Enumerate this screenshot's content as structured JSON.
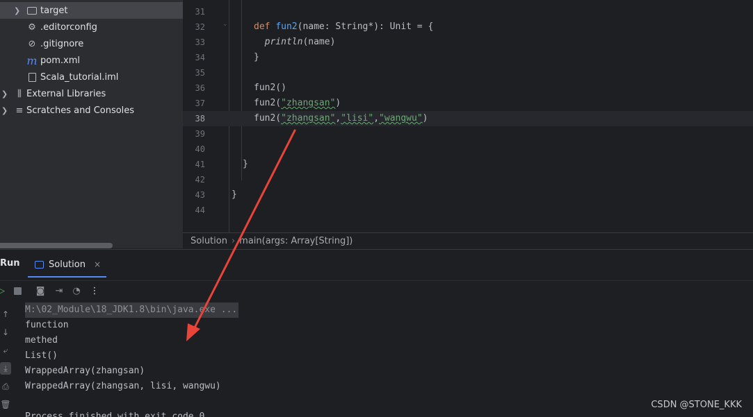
{
  "project_tree": {
    "items": [
      {
        "label": "target",
        "icon": "folder-icon",
        "expandable": true
      },
      {
        "label": ".editorconfig",
        "icon": "gear-icon"
      },
      {
        "label": ".gitignore",
        "icon": "ignore-file-icon"
      },
      {
        "label": "pom.xml",
        "icon": "maven-icon",
        "icon_glyph": "m"
      },
      {
        "label": "Scala_tutorial.iml",
        "icon": "file-icon"
      },
      {
        "label": "External Libraries",
        "icon": "library-icon",
        "expandable": true
      },
      {
        "label": "Scratches and Consoles",
        "icon": "scratches-icon",
        "expandable": true
      }
    ]
  },
  "editor": {
    "current_line": 38,
    "lines": [
      {
        "num": "31"
      },
      {
        "num": "32",
        "tokens": [
          {
            "t": "def ",
            "c": "kw"
          },
          {
            "t": "fun2",
            "c": "fn"
          },
          {
            "t": "(name: String*): Unit = {",
            "c": ""
          }
        ]
      },
      {
        "num": "33",
        "tokens": [
          {
            "t": "  ",
            "c": ""
          },
          {
            "t": "println",
            "c": "it"
          },
          {
            "t": "(name)",
            "c": ""
          }
        ]
      },
      {
        "num": "34",
        "tokens": [
          {
            "t": "}",
            "c": ""
          }
        ]
      },
      {
        "num": "35"
      },
      {
        "num": "36",
        "tokens": [
          {
            "t": "fun2()",
            "c": ""
          }
        ]
      },
      {
        "num": "37",
        "tokens": [
          {
            "t": "fun2(",
            "c": ""
          },
          {
            "t": "\"zhangsan\"",
            "c": "str"
          },
          {
            "t": ")",
            "c": ""
          }
        ]
      },
      {
        "num": "38",
        "tokens": [
          {
            "t": "fun2(",
            "c": ""
          },
          {
            "t": "\"zhangsan\"",
            "c": "str"
          },
          {
            "t": ",",
            "c": ""
          },
          {
            "t": "\"lisi\"",
            "c": "str"
          },
          {
            "t": ",",
            "c": ""
          },
          {
            "t": "\"wangwu\"",
            "c": "str"
          },
          {
            "t": ")",
            "c": ""
          }
        ]
      },
      {
        "num": "39"
      },
      {
        "num": "40"
      },
      {
        "num": "41",
        "tokens": [
          {
            "t": "}",
            "c": ""
          }
        ]
      },
      {
        "num": "42"
      },
      {
        "num": "43",
        "tokens": [
          {
            "t": "}",
            "c": ""
          }
        ]
      },
      {
        "num": "44"
      }
    ]
  },
  "breadcrumb": {
    "class_name": "Solution",
    "separator": "›",
    "method": "main(args: Array[String])"
  },
  "run_window": {
    "title": "Run",
    "tab_label": "Solution",
    "close_glyph": "×",
    "console": [
      "M:\\02_Module\\18_JDK1.8\\bin\\java.exe ...",
      "function",
      "methed",
      "List()",
      "WrappedArray(zhangsan)",
      "WrappedArray(zhangsan, lisi, wangwu)",
      "",
      "Process finished with exit code 0"
    ]
  },
  "watermark": "CSDN @STONE_KKK",
  "colors": {
    "accent": "#548af7",
    "string": "#6aab73",
    "keyword": "#cf8e6d",
    "function": "#56a8f5",
    "annotation_arrow": "#e8443a"
  }
}
